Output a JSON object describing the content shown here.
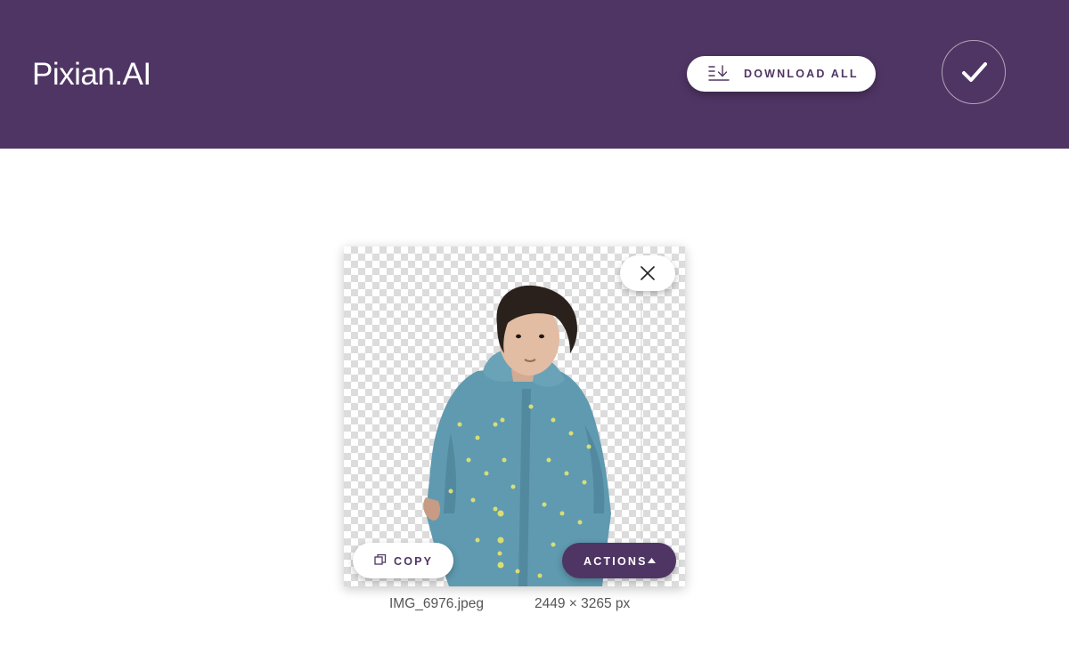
{
  "app": {
    "title": "Pixian.AI"
  },
  "header": {
    "download_all_label": "DOWNLOAD ALL"
  },
  "card": {
    "copy_label": "COPY",
    "actions_label": "ACTIONS",
    "filename": "IMG_6976.jpeg",
    "dimensions": "2449 × 3265 px"
  },
  "colors": {
    "brand": "#4f3564",
    "background": "#ffffff",
    "checker": "#dcdcdc"
  },
  "icons": {
    "download": "download-all-icon",
    "check": "checkmark-icon",
    "close": "close-icon",
    "copy": "copy-icon",
    "caret": "caret-up-icon"
  }
}
